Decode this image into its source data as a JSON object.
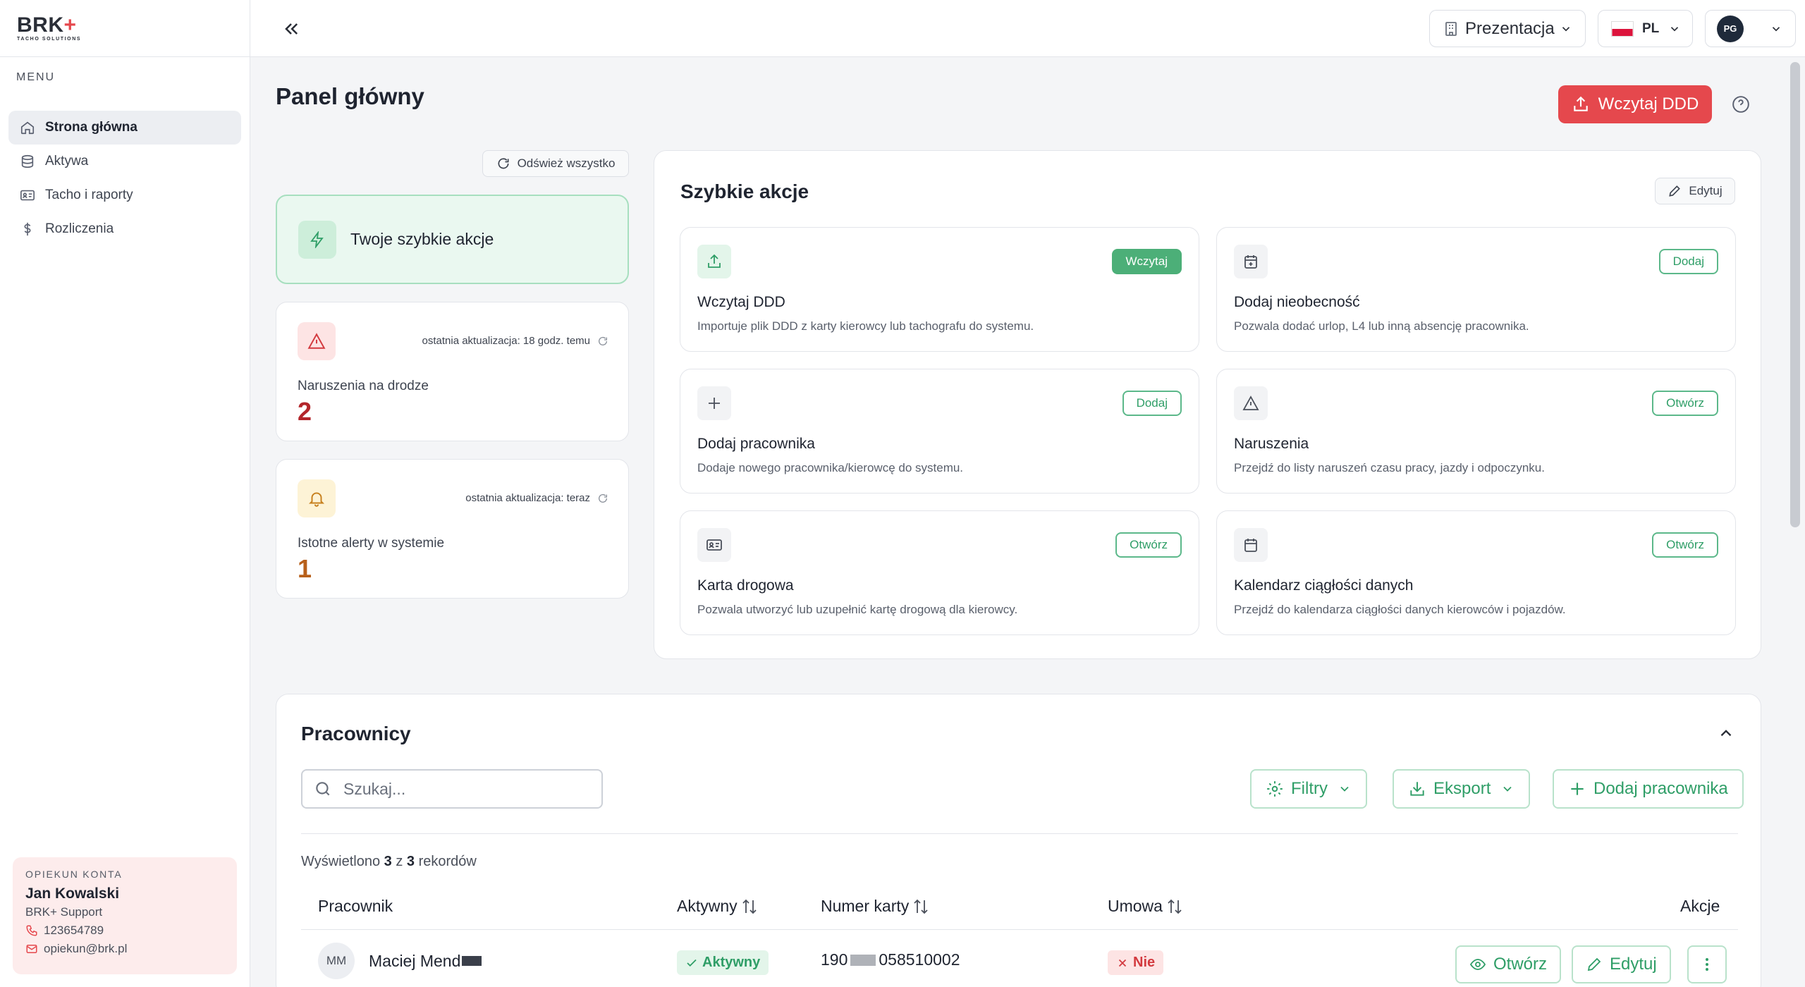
{
  "logo": {
    "main": "BRK",
    "plus": "+",
    "sub": "TACHO SOLUTIONS"
  },
  "sidebar": {
    "menu_label": "MENU",
    "items": [
      {
        "label": "Strona główna",
        "icon": "home-icon",
        "active": true
      },
      {
        "label": "Aktywa",
        "icon": "database-icon",
        "active": false
      },
      {
        "label": "Tacho i raporty",
        "icon": "id-card-icon",
        "active": false
      },
      {
        "label": "Rozliczenia",
        "icon": "dollar-icon",
        "active": false
      }
    ]
  },
  "account": {
    "label": "OPIEKUN KONTA",
    "name": "Jan Kowalski",
    "role": "BRK+ Support",
    "phone": "123654789",
    "email": "opiekun@brk.pl"
  },
  "topbar": {
    "organization": "Prezentacja",
    "language": "PL",
    "user_initials": "PG"
  },
  "page": {
    "title": "Panel główny",
    "primary_button": "Wczytaj DDD",
    "refresh_label": "Odśwież wszystko",
    "quick_actions_card": "Twoje szybkie akcje"
  },
  "stats": [
    {
      "title": "Naruszenia na drodze",
      "value": "2",
      "updated": "ostatnia aktualizacja: 18 godz. temu",
      "color": "#b3262b"
    },
    {
      "title": "Istotne alerty w systemie",
      "value": "1",
      "updated": "ostatnia aktualizacja: teraz",
      "color": "#b8601a"
    }
  ],
  "quick_actions": {
    "title": "Szybkie akcje",
    "edit_label": "Edytuj",
    "items": [
      {
        "title": "Wczytaj DDD",
        "desc": "Importuje plik DDD z karty kierowcy lub tachografu do systemu.",
        "button": "Wczytaj",
        "icon": "upload-icon"
      },
      {
        "title": "Dodaj nieobecność",
        "desc": "Pozwala dodać urlop, L4 lub inną absencję pracownika.",
        "button": "Dodaj",
        "icon": "calendar-plus-icon"
      },
      {
        "title": "Dodaj pracownika",
        "desc": "Dodaje nowego pracownika/kierowcę do systemu.",
        "button": "Dodaj",
        "icon": "plus-icon"
      },
      {
        "title": "Naruszenia",
        "desc": "Przejdź do listy naruszeń czasu pracy, jazdy i odpoczynku.",
        "button": "Otwórz",
        "icon": "warning-icon"
      },
      {
        "title": "Karta drogowa",
        "desc": "Pozwala utworzyć lub uzupełnić kartę drogową dla kierowcy.",
        "button": "Otwórz",
        "icon": "id-card-icon"
      },
      {
        "title": "Kalendarz ciągłości danych",
        "desc": "Przejdź do kalendarza ciągłości danych kierowców i pojazdów.",
        "button": "Otwórz",
        "icon": "calendar-icon"
      }
    ]
  },
  "employees": {
    "title": "Pracownicy",
    "search_placeholder": "Szukaj...",
    "filters_label": "Filtry",
    "export_label": "Eksport",
    "add_label": "Dodaj pracownika",
    "records_prefix": "Wyświetlono",
    "records_shown": "3",
    "records_of": "z",
    "records_total": "3",
    "records_suffix": "rekordów",
    "columns": [
      "Pracownik",
      "Aktywny",
      "Numer karty",
      "Umowa",
      "Akcje"
    ],
    "rows": [
      {
        "initials": "MM",
        "name": "Maciej Mend",
        "active": "Aktywny",
        "card_start": "190",
        "card_end": "058510002",
        "contract": "Nie",
        "open": "Otwórz",
        "edit": "Edytuj"
      }
    ]
  }
}
